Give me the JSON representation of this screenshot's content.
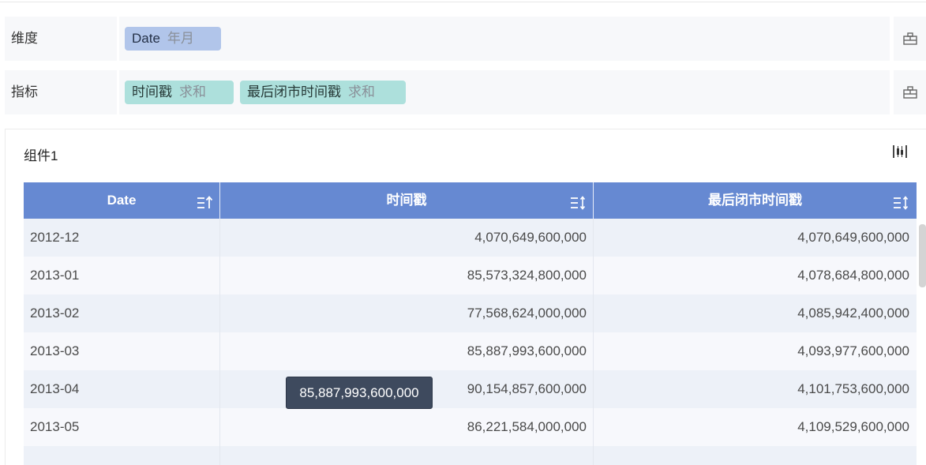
{
  "fields": {
    "dimension": {
      "label": "维度",
      "items": [
        {
          "name": "Date",
          "agg": "年月"
        }
      ]
    },
    "metric": {
      "label": "指标",
      "items": [
        {
          "name": "时间戳",
          "agg": "求和"
        },
        {
          "name": "最后闭市时间戳",
          "agg": "求和"
        }
      ]
    }
  },
  "component": {
    "title": "组件1"
  },
  "table": {
    "columns": [
      "Date",
      "时间戳",
      "最后闭市时间戳"
    ],
    "rows": [
      [
        "2012-12",
        "4,070,649,600,000",
        "4,070,649,600,000"
      ],
      [
        "2013-01",
        "85,573,324,800,000",
        "4,078,684,800,000"
      ],
      [
        "2013-02",
        "77,568,624,000,000",
        "4,085,942,400,000"
      ],
      [
        "2013-03",
        "85,887,993,600,000",
        "4,093,977,600,000"
      ],
      [
        "2013-04",
        "90,154,857,600,000",
        "4,101,753,600,000"
      ],
      [
        "2013-05",
        "86,221,584,000,000",
        "4,109,529,600,000"
      ],
      [
        "",
        "",
        ""
      ]
    ]
  },
  "tooltip": {
    "text": "85,887,993,600,000"
  },
  "icons": {
    "field_tool": "field-settings-icon",
    "panel_tool": "chart-type-icon",
    "sort_asc": "sort-ascending-icon",
    "sort": "sort-icon"
  },
  "colors": {
    "header": "#6689d2",
    "dimension_pill": "#b1c5ea",
    "metric_pill": "#ade0dc",
    "tooltip_bg": "#3e4a5e"
  }
}
